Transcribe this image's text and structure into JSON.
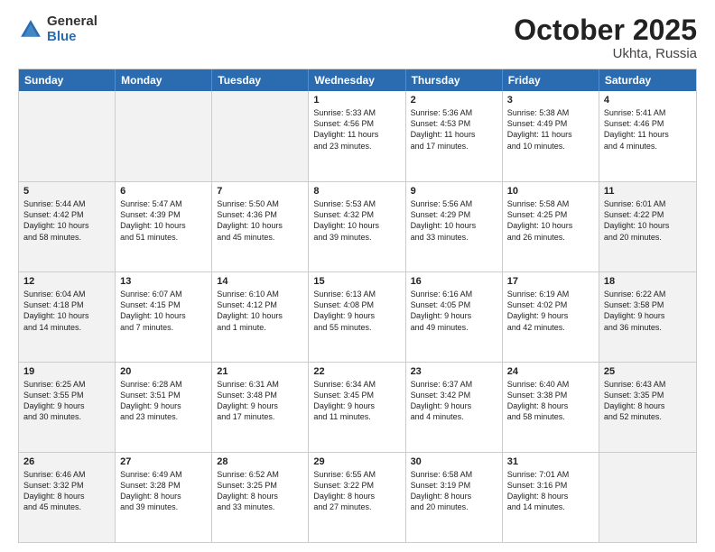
{
  "logo": {
    "general": "General",
    "blue": "Blue"
  },
  "title": {
    "month": "October 2025",
    "location": "Ukhta, Russia"
  },
  "header_days": [
    "Sunday",
    "Monday",
    "Tuesday",
    "Wednesday",
    "Thursday",
    "Friday",
    "Saturday"
  ],
  "weeks": [
    [
      {
        "day": "",
        "text": "",
        "shaded": true
      },
      {
        "day": "",
        "text": "",
        "shaded": true
      },
      {
        "day": "",
        "text": "",
        "shaded": true
      },
      {
        "day": "1",
        "text": "Sunrise: 5:33 AM\nSunset: 4:56 PM\nDaylight: 11 hours\nand 23 minutes.",
        "shaded": false
      },
      {
        "day": "2",
        "text": "Sunrise: 5:36 AM\nSunset: 4:53 PM\nDaylight: 11 hours\nand 17 minutes.",
        "shaded": false
      },
      {
        "day": "3",
        "text": "Sunrise: 5:38 AM\nSunset: 4:49 PM\nDaylight: 11 hours\nand 10 minutes.",
        "shaded": false
      },
      {
        "day": "4",
        "text": "Sunrise: 5:41 AM\nSunset: 4:46 PM\nDaylight: 11 hours\nand 4 minutes.",
        "shaded": false
      }
    ],
    [
      {
        "day": "5",
        "text": "Sunrise: 5:44 AM\nSunset: 4:42 PM\nDaylight: 10 hours\nand 58 minutes.",
        "shaded": true
      },
      {
        "day": "6",
        "text": "Sunrise: 5:47 AM\nSunset: 4:39 PM\nDaylight: 10 hours\nand 51 minutes.",
        "shaded": false
      },
      {
        "day": "7",
        "text": "Sunrise: 5:50 AM\nSunset: 4:36 PM\nDaylight: 10 hours\nand 45 minutes.",
        "shaded": false
      },
      {
        "day": "8",
        "text": "Sunrise: 5:53 AM\nSunset: 4:32 PM\nDaylight: 10 hours\nand 39 minutes.",
        "shaded": false
      },
      {
        "day": "9",
        "text": "Sunrise: 5:56 AM\nSunset: 4:29 PM\nDaylight: 10 hours\nand 33 minutes.",
        "shaded": false
      },
      {
        "day": "10",
        "text": "Sunrise: 5:58 AM\nSunset: 4:25 PM\nDaylight: 10 hours\nand 26 minutes.",
        "shaded": false
      },
      {
        "day": "11",
        "text": "Sunrise: 6:01 AM\nSunset: 4:22 PM\nDaylight: 10 hours\nand 20 minutes.",
        "shaded": true
      }
    ],
    [
      {
        "day": "12",
        "text": "Sunrise: 6:04 AM\nSunset: 4:18 PM\nDaylight: 10 hours\nand 14 minutes.",
        "shaded": true
      },
      {
        "day": "13",
        "text": "Sunrise: 6:07 AM\nSunset: 4:15 PM\nDaylight: 10 hours\nand 7 minutes.",
        "shaded": false
      },
      {
        "day": "14",
        "text": "Sunrise: 6:10 AM\nSunset: 4:12 PM\nDaylight: 10 hours\nand 1 minute.",
        "shaded": false
      },
      {
        "day": "15",
        "text": "Sunrise: 6:13 AM\nSunset: 4:08 PM\nDaylight: 9 hours\nand 55 minutes.",
        "shaded": false
      },
      {
        "day": "16",
        "text": "Sunrise: 6:16 AM\nSunset: 4:05 PM\nDaylight: 9 hours\nand 49 minutes.",
        "shaded": false
      },
      {
        "day": "17",
        "text": "Sunrise: 6:19 AM\nSunset: 4:02 PM\nDaylight: 9 hours\nand 42 minutes.",
        "shaded": false
      },
      {
        "day": "18",
        "text": "Sunrise: 6:22 AM\nSunset: 3:58 PM\nDaylight: 9 hours\nand 36 minutes.",
        "shaded": true
      }
    ],
    [
      {
        "day": "19",
        "text": "Sunrise: 6:25 AM\nSunset: 3:55 PM\nDaylight: 9 hours\nand 30 minutes.",
        "shaded": true
      },
      {
        "day": "20",
        "text": "Sunrise: 6:28 AM\nSunset: 3:51 PM\nDaylight: 9 hours\nand 23 minutes.",
        "shaded": false
      },
      {
        "day": "21",
        "text": "Sunrise: 6:31 AM\nSunset: 3:48 PM\nDaylight: 9 hours\nand 17 minutes.",
        "shaded": false
      },
      {
        "day": "22",
        "text": "Sunrise: 6:34 AM\nSunset: 3:45 PM\nDaylight: 9 hours\nand 11 minutes.",
        "shaded": false
      },
      {
        "day": "23",
        "text": "Sunrise: 6:37 AM\nSunset: 3:42 PM\nDaylight: 9 hours\nand 4 minutes.",
        "shaded": false
      },
      {
        "day": "24",
        "text": "Sunrise: 6:40 AM\nSunset: 3:38 PM\nDaylight: 8 hours\nand 58 minutes.",
        "shaded": false
      },
      {
        "day": "25",
        "text": "Sunrise: 6:43 AM\nSunset: 3:35 PM\nDaylight: 8 hours\nand 52 minutes.",
        "shaded": true
      }
    ],
    [
      {
        "day": "26",
        "text": "Sunrise: 6:46 AM\nSunset: 3:32 PM\nDaylight: 8 hours\nand 45 minutes.",
        "shaded": true
      },
      {
        "day": "27",
        "text": "Sunrise: 6:49 AM\nSunset: 3:28 PM\nDaylight: 8 hours\nand 39 minutes.",
        "shaded": false
      },
      {
        "day": "28",
        "text": "Sunrise: 6:52 AM\nSunset: 3:25 PM\nDaylight: 8 hours\nand 33 minutes.",
        "shaded": false
      },
      {
        "day": "29",
        "text": "Sunrise: 6:55 AM\nSunset: 3:22 PM\nDaylight: 8 hours\nand 27 minutes.",
        "shaded": false
      },
      {
        "day": "30",
        "text": "Sunrise: 6:58 AM\nSunset: 3:19 PM\nDaylight: 8 hours\nand 20 minutes.",
        "shaded": false
      },
      {
        "day": "31",
        "text": "Sunrise: 7:01 AM\nSunset: 3:16 PM\nDaylight: 8 hours\nand 14 minutes.",
        "shaded": false
      },
      {
        "day": "",
        "text": "",
        "shaded": true
      }
    ]
  ]
}
